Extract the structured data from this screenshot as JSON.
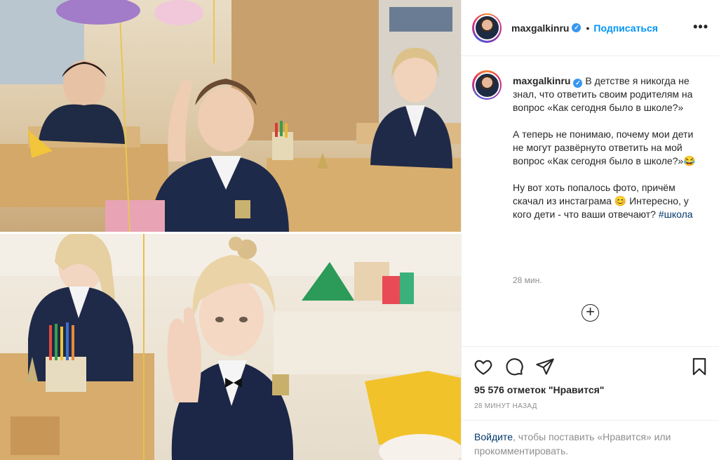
{
  "post": {
    "username": "maxgalkinru",
    "verified_mark": "✓",
    "separator": "•",
    "follow_label": "Подписаться",
    "more_label": "•••"
  },
  "caption": {
    "username": "maxgalkinru",
    "paragraph1": "В детстве я никогда не знал, что ответить своим родителям на вопрос «Как сегодня было в школе?»",
    "paragraph2": "А теперь не понимаю, почему мои дети не могут развёрнуто ответить на мой вопрос «Как сегодня было в школе?»😂",
    "paragraph3_text": "Ну вот хоть попалось фото, причём скачал из инстаграма 😊 Интересно, у кого дети - что ваши отвечают? ",
    "hashtag": "#школа",
    "time": "28 мин."
  },
  "load_more": "+",
  "actions": {
    "like": "heart-icon",
    "comment": "comment-icon",
    "share": "share-icon",
    "save": "bookmark-icon"
  },
  "likes_text": "95 576 отметок \"Нравится\"",
  "date_text": "28 МИНУТ НАЗАД",
  "login_prompt": {
    "link": "Войдите",
    "rest": ", чтобы поставить «Нравится» или прокомментировать."
  },
  "colors": {
    "accent": "#0095f6",
    "verified": "#3897f0",
    "text": "#262626",
    "muted": "#8e8e8e",
    "border": "#efefef"
  }
}
